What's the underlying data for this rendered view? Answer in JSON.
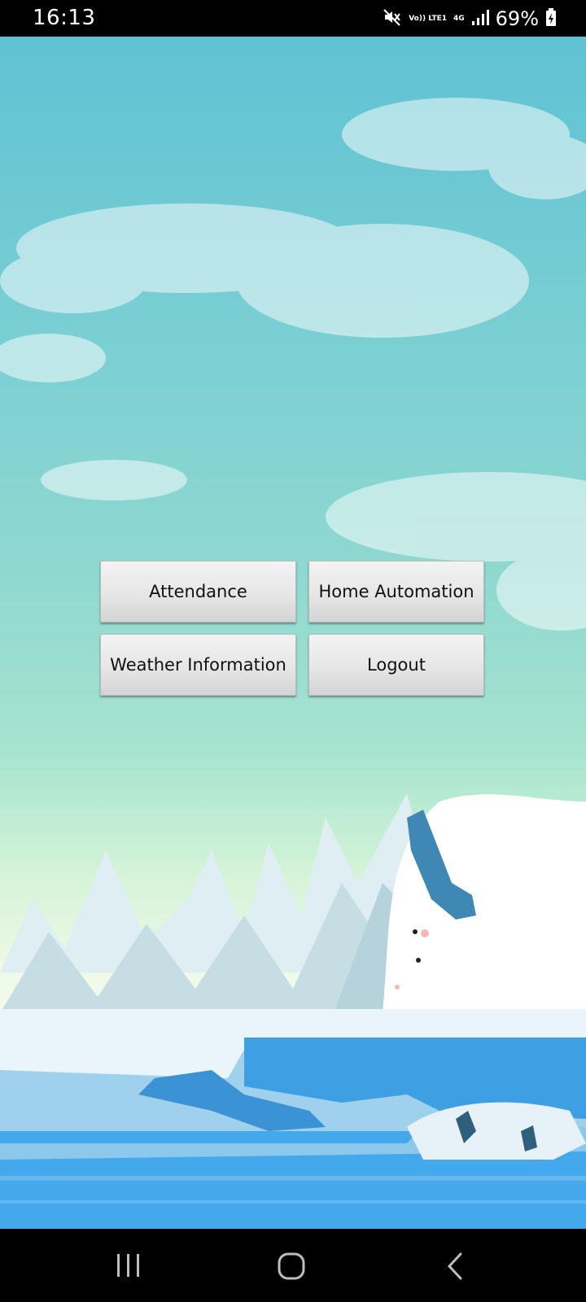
{
  "status_bar": {
    "time": "16:13",
    "network_volte": "Vo)) LTE1",
    "network_type": "4G",
    "battery_percent": "69%",
    "icons": [
      "mute-icon",
      "signal-icon",
      "battery-charging-icon"
    ]
  },
  "menu": {
    "attendance_label": "Attendance",
    "home_automation_label": "Home Automation",
    "weather_label": "Weather Information",
    "logout_label": "Logout"
  },
  "nav_bar": {
    "icons": [
      "recent-apps-icon",
      "home-icon",
      "back-icon"
    ]
  },
  "colors": {
    "sky_top": "#5fc2d3",
    "sky_bottom": "#eef9e6",
    "water": "#3fa3e6",
    "button_face": "#e6e6e6"
  }
}
